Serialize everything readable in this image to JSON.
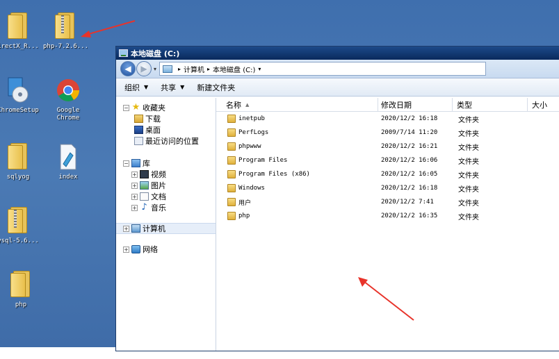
{
  "desktop": {
    "icons": [
      {
        "label": "irectX_R...",
        "icon": "folder-icon"
      },
      {
        "label": "php-7.2.6...",
        "icon": "zip-folder-icon"
      },
      {
        "label": "ChromeSetup",
        "icon": "setup-disc-icon"
      },
      {
        "label": "Google Chrome",
        "icon": "chrome-icon"
      },
      {
        "label": "sqlyog",
        "icon": "folder-icon"
      },
      {
        "label": "index",
        "icon": "document-icon"
      },
      {
        "label": "ysql-5.6...",
        "icon": "zip-folder-icon"
      },
      {
        "label": "php",
        "icon": "folder-icon"
      }
    ]
  },
  "window": {
    "title": "本地磁盘 (C:)",
    "address": {
      "crumb1": "计算机",
      "crumb2": "本地磁盘 (C:)",
      "sep": "▸"
    },
    "toolbar": {
      "organize": "组织",
      "share": "共享",
      "new_folder": "新建文件夹"
    },
    "nav": {
      "favorites": "收藏夹",
      "downloads": "下载",
      "desktop": "桌面",
      "recent": "最近访问的位置",
      "libraries": "库",
      "videos": "视频",
      "pictures": "图片",
      "documents": "文档",
      "music": "音乐",
      "computer": "计算机",
      "network": "网络"
    },
    "columns": {
      "name": "名称",
      "date": "修改日期",
      "type": "类型",
      "size": "大小"
    },
    "files": [
      {
        "name": "inetpub",
        "date": "2020/12/2 16:18",
        "type": "文件夹"
      },
      {
        "name": "PerfLogs",
        "date": "2009/7/14 11:20",
        "type": "文件夹"
      },
      {
        "name": "phpwww",
        "date": "2020/12/2 16:21",
        "type": "文件夹"
      },
      {
        "name": "Program Files",
        "date": "2020/12/2 16:06",
        "type": "文件夹"
      },
      {
        "name": "Program Files (x86)",
        "date": "2020/12/2 16:05",
        "type": "文件夹"
      },
      {
        "name": "Windows",
        "date": "2020/12/2 16:18",
        "type": "文件夹"
      },
      {
        "name": "用户",
        "date": "2020/12/2 7:41",
        "type": "文件夹"
      },
      {
        "name": "php",
        "date": "2020/12/2 16:35",
        "type": "文件夹"
      }
    ]
  },
  "colors": {
    "desktop": "#4a78b0",
    "titlebar": "#0b2f66",
    "annotation_arrow": "#e8332a"
  }
}
